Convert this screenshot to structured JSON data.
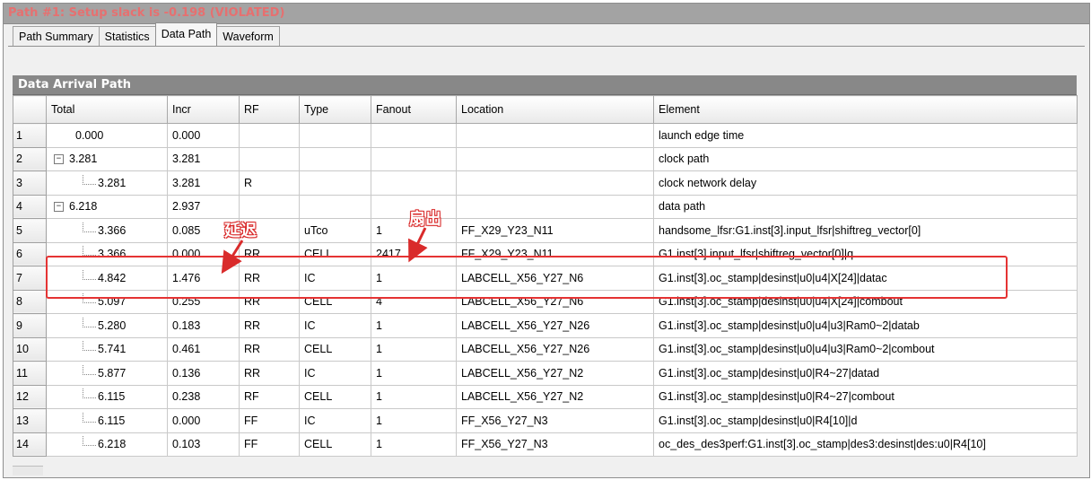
{
  "window": {
    "title": "Path #1: Setup slack is -0.198 (VIOLATED)"
  },
  "tabs": [
    {
      "label": "Path Summary",
      "active": false
    },
    {
      "label": "Statistics",
      "active": false
    },
    {
      "label": "Data Path",
      "active": true
    },
    {
      "label": "Waveform",
      "active": false
    }
  ],
  "section": {
    "title": "Data Arrival Path"
  },
  "columns": [
    "Total",
    "Incr",
    "RF",
    "Type",
    "Fanout",
    "Location",
    "Element"
  ],
  "rows": [
    {
      "idx": "1",
      "total": "0.000",
      "incr": "0.000",
      "rf": "",
      "type": "",
      "fanout": "",
      "location": "",
      "element": "launch edge time"
    },
    {
      "idx": "2",
      "total": "3.281",
      "incr": "3.281",
      "rf": "",
      "type": "",
      "fanout": "",
      "location": "",
      "element": "clock path"
    },
    {
      "idx": "3",
      "total": "3.281",
      "incr": "3.281",
      "rf": "R",
      "type": "",
      "fanout": "",
      "location": "",
      "element": "clock network delay"
    },
    {
      "idx": "4",
      "total": "6.218",
      "incr": "2.937",
      "rf": "",
      "type": "",
      "fanout": "",
      "location": "",
      "element": "data path"
    },
    {
      "idx": "5",
      "total": "3.366",
      "incr": "0.085",
      "rf": "",
      "type": "uTco",
      "fanout": "1",
      "location": "FF_X29_Y23_N11",
      "element": "handsome_lfsr:G1.inst[3].input_lfsr|shiftreg_vector[0]"
    },
    {
      "idx": "6",
      "total": "3.366",
      "incr": "0.000",
      "rf": "RR",
      "type": "CELL",
      "fanout": "2417",
      "location": "FF_X29_Y23_N11",
      "element": "G1.inst[3].input_lfsr|shiftreg_vector[0]|q"
    },
    {
      "idx": "7",
      "total": "4.842",
      "incr": "1.476",
      "rf": "RR",
      "type": "IC",
      "fanout": "1",
      "location": "LABCELL_X56_Y27_N6",
      "element": "G1.inst[3].oc_stamp|desinst|u0|u4|X[24]|datac"
    },
    {
      "idx": "8",
      "total": "5.097",
      "incr": "0.255",
      "rf": "RR",
      "type": "CELL",
      "fanout": "4",
      "location": "LABCELL_X56_Y27_N6",
      "element": "G1.inst[3].oc_stamp|desinst|u0|u4|X[24]|combout"
    },
    {
      "idx": "9",
      "total": "5.280",
      "incr": "0.183",
      "rf": "RR",
      "type": "IC",
      "fanout": "1",
      "location": "LABCELL_X56_Y27_N26",
      "element": "G1.inst[3].oc_stamp|desinst|u0|u4|u3|Ram0~2|datab"
    },
    {
      "idx": "10",
      "total": "5.741",
      "incr": "0.461",
      "rf": "RR",
      "type": "CELL",
      "fanout": "1",
      "location": "LABCELL_X56_Y27_N26",
      "element": "G1.inst[3].oc_stamp|desinst|u0|u4|u3|Ram0~2|combout"
    },
    {
      "idx": "11",
      "total": "5.877",
      "incr": "0.136",
      "rf": "RR",
      "type": "IC",
      "fanout": "1",
      "location": "LABCELL_X56_Y27_N2",
      "element": "G1.inst[3].oc_stamp|desinst|u0|R4~27|datad"
    },
    {
      "idx": "12",
      "total": "6.115",
      "incr": "0.238",
      "rf": "RF",
      "type": "CELL",
      "fanout": "1",
      "location": "LABCELL_X56_Y27_N2",
      "element": "G1.inst[3].oc_stamp|desinst|u0|R4~27|combout"
    },
    {
      "idx": "13",
      "total": "6.115",
      "incr": "0.000",
      "rf": "FF",
      "type": "IC",
      "fanout": "1",
      "location": "FF_X56_Y27_N3",
      "element": "G1.inst[3].oc_stamp|desinst|u0|R4[10]|d"
    },
    {
      "idx": "14",
      "total": "6.218",
      "incr": "0.103",
      "rf": "FF",
      "type": "CELL",
      "fanout": "1",
      "location": "FF_X56_Y27_N3",
      "element": "oc_des_des3perf:G1.inst[3].oc_stamp|des3:desinst|des:u0|R4[10]"
    }
  ],
  "annotations": {
    "delay": "延迟",
    "fanout": "扇出"
  },
  "icons": {
    "expand_collapse": "minus-box-icon",
    "tree_connector": "tree-branch-icon"
  },
  "colors": {
    "title_text": "#e06060",
    "highlight": "#e53333",
    "header_bg": "#888888"
  }
}
